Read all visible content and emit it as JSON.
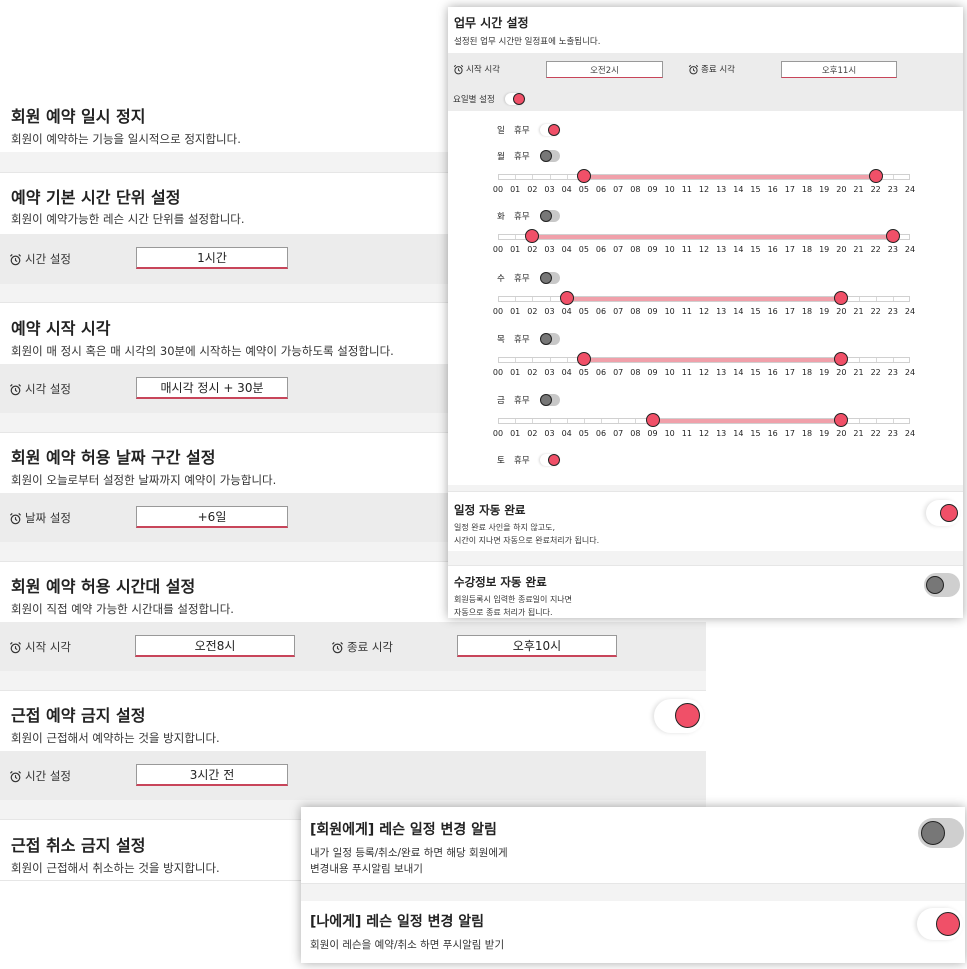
{
  "colors": {
    "accent": "#f05068",
    "range": "#f0a0aa",
    "row_bg": "#ececec",
    "toggle_off": "#cfcfcf"
  },
  "pause": {
    "title": "회원 예약 일시 정지",
    "desc": "회원이 예약하는 기능을 일시적으로 정지합니다."
  },
  "unit": {
    "title": "예약 기본 시간 단위 설정",
    "desc": "회원이 예약가능한 레슨 시간 단위를 설정합니다.",
    "label": "시간 설정",
    "value": "1시간"
  },
  "start": {
    "title": "예약 시작 시각",
    "desc": "회원이 매 정시 혹은 매 시각의 30분에 시작하는 예약이 가능하도록 설정합니다.",
    "label": "시각 설정",
    "value": "매시각 정시 + 30분"
  },
  "date_range": {
    "title": "회원 예약 허용 날짜 구간 설정",
    "desc": "회원이 오늘로부터 설정한 날짜까지 예약이 가능합니다.",
    "label": "날짜 설정",
    "value": "+6일"
  },
  "time_range": {
    "title": "회원 예약 허용 시간대 설정",
    "desc": "회원이 직접 예약 가능한 시간대를 설정합니다.",
    "start_label": "시작 시각",
    "start_value": "오전8시",
    "end_label": "종료 시각",
    "end_value": "오후10시"
  },
  "near_booking": {
    "title": "근접 예약 금지 설정",
    "desc": "회원이 근접해서 예약하는 것을 방지합니다.",
    "label": "시간 설정",
    "value": "3시간 전",
    "toggle_on": true
  },
  "near_cancel": {
    "title": "근접 취소 금지 설정",
    "desc": "회원이 근접해서 취소하는 것을 방지합니다."
  },
  "work_hours": {
    "title": "업무 시간 설정",
    "subtitle": "설정된 업무 시간만 일정표에 노출됩니다.",
    "start_label": "시작 시각",
    "start_value": "오전2시",
    "end_label": "종료 시각",
    "end_value": "오후11시",
    "per_day_label": "요일별 설정",
    "per_day_on": true,
    "off_label": "휴무",
    "hours": [
      "00",
      "01",
      "02",
      "03",
      "04",
      "05",
      "06",
      "07",
      "08",
      "09",
      "10",
      "11",
      "12",
      "13",
      "14",
      "15",
      "16",
      "17",
      "18",
      "19",
      "20",
      "21",
      "22",
      "23",
      "24"
    ],
    "days": [
      {
        "name": "일",
        "off": true,
        "start": null,
        "end": null
      },
      {
        "name": "월",
        "off": false,
        "start": 5,
        "end": 22
      },
      {
        "name": "화",
        "off": false,
        "start": 2,
        "end": 23
      },
      {
        "name": "수",
        "off": false,
        "start": 4,
        "end": 20
      },
      {
        "name": "목",
        "off": false,
        "start": 5,
        "end": 20
      },
      {
        "name": "금",
        "off": false,
        "start": 9,
        "end": 20
      },
      {
        "name": "토",
        "off": true,
        "start": null,
        "end": null
      }
    ]
  },
  "auto_complete": {
    "title": "일정 자동 완료",
    "desc_line1": "일정 완료 사인을 하지 않고도,",
    "desc_line2": "시간이 지나면 자동으로 완료처리가 됩니다.",
    "toggle_on": true
  },
  "lesson_auto_complete": {
    "title": "수강정보 자동 완료",
    "desc_line1": "회원등록시 입력한 종료일이 지나면",
    "desc_line2": "자동으로 종료 처리가 됩니다.",
    "toggle_on": false
  },
  "notify_member": {
    "title": "[회원에게] 레슨 일정 변경 알림",
    "desc_line1": "내가 일정 등록/취소/완료 하면 해당 회원에게",
    "desc_line2": "변경내용 푸시알림 보내기",
    "toggle_on": false
  },
  "notify_me": {
    "title": "[나에게] 레슨 일정 변경 알림",
    "desc": "회원이 레슨을 예약/취소 하면 푸시알림 받기",
    "toggle_on": true
  }
}
